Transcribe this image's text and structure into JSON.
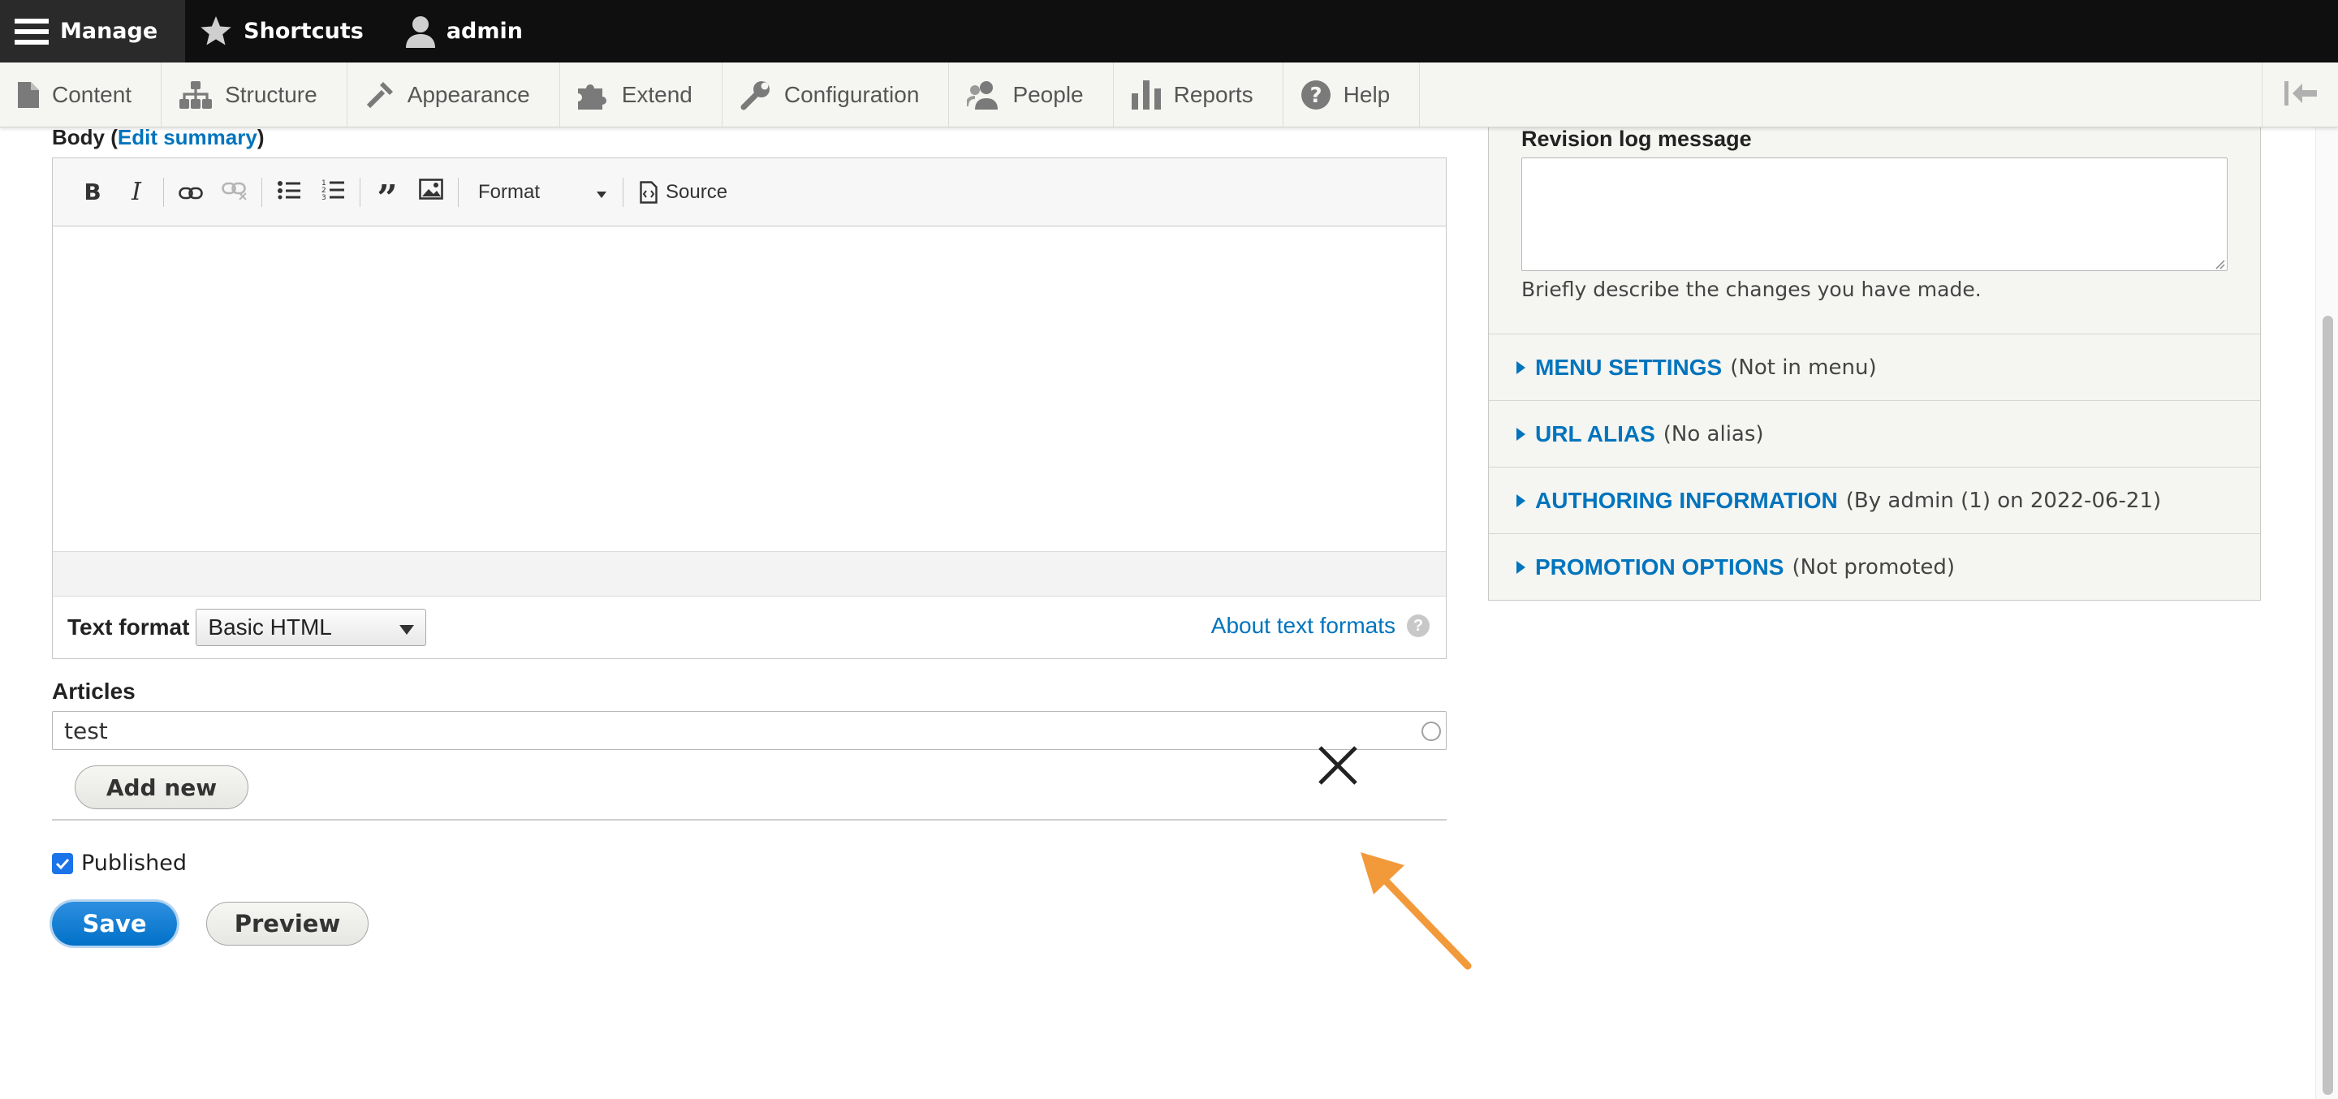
{
  "toolbar": {
    "manage": "Manage",
    "shortcuts": "Shortcuts",
    "user": "admin"
  },
  "tray": {
    "tabs": [
      {
        "label": "Content",
        "icon": "file-icon"
      },
      {
        "label": "Structure",
        "icon": "sitemap-icon"
      },
      {
        "label": "Appearance",
        "icon": "paint-brush-icon"
      },
      {
        "label": "Extend",
        "icon": "puzzle-icon"
      },
      {
        "label": "Configuration",
        "icon": "wrench-icon"
      },
      {
        "label": "People",
        "icon": "people-icon"
      },
      {
        "label": "Reports",
        "icon": "bar-chart-icon"
      },
      {
        "label": "Help",
        "icon": "help-icon"
      }
    ]
  },
  "body_field": {
    "label_prefix": "Body (",
    "edit_summary": "Edit summary",
    "label_suffix": ")"
  },
  "editor": {
    "format_label": "Format",
    "source_label": "Source",
    "text_format_label": "Text format",
    "text_format_value": "Basic HTML",
    "about_text_formats": "About text formats",
    "help_glyph": "?"
  },
  "articles": {
    "label": "Articles",
    "value": "test",
    "add_new": "Add new"
  },
  "published": {
    "label": "Published",
    "checked": true
  },
  "actions": {
    "save": "Save",
    "preview": "Preview"
  },
  "sidebar": {
    "revision_label": "Revision log message",
    "revision_help": "Briefly describe the changes you have made.",
    "sections": [
      {
        "title": "MENU SETTINGS",
        "summary": "(Not in menu)"
      },
      {
        "title": "URL ALIAS",
        "summary": "(No alias)"
      },
      {
        "title": "AUTHORING INFORMATION",
        "summary": "(By admin (1) on 2022-06-21)"
      },
      {
        "title": "PROMOTION OPTIONS",
        "summary": "(Not promoted)"
      }
    ]
  },
  "colors": {
    "link_blue": "#0074bd",
    "primary_button": "#0071c8",
    "annotation_arrow": "#f29a3a"
  }
}
